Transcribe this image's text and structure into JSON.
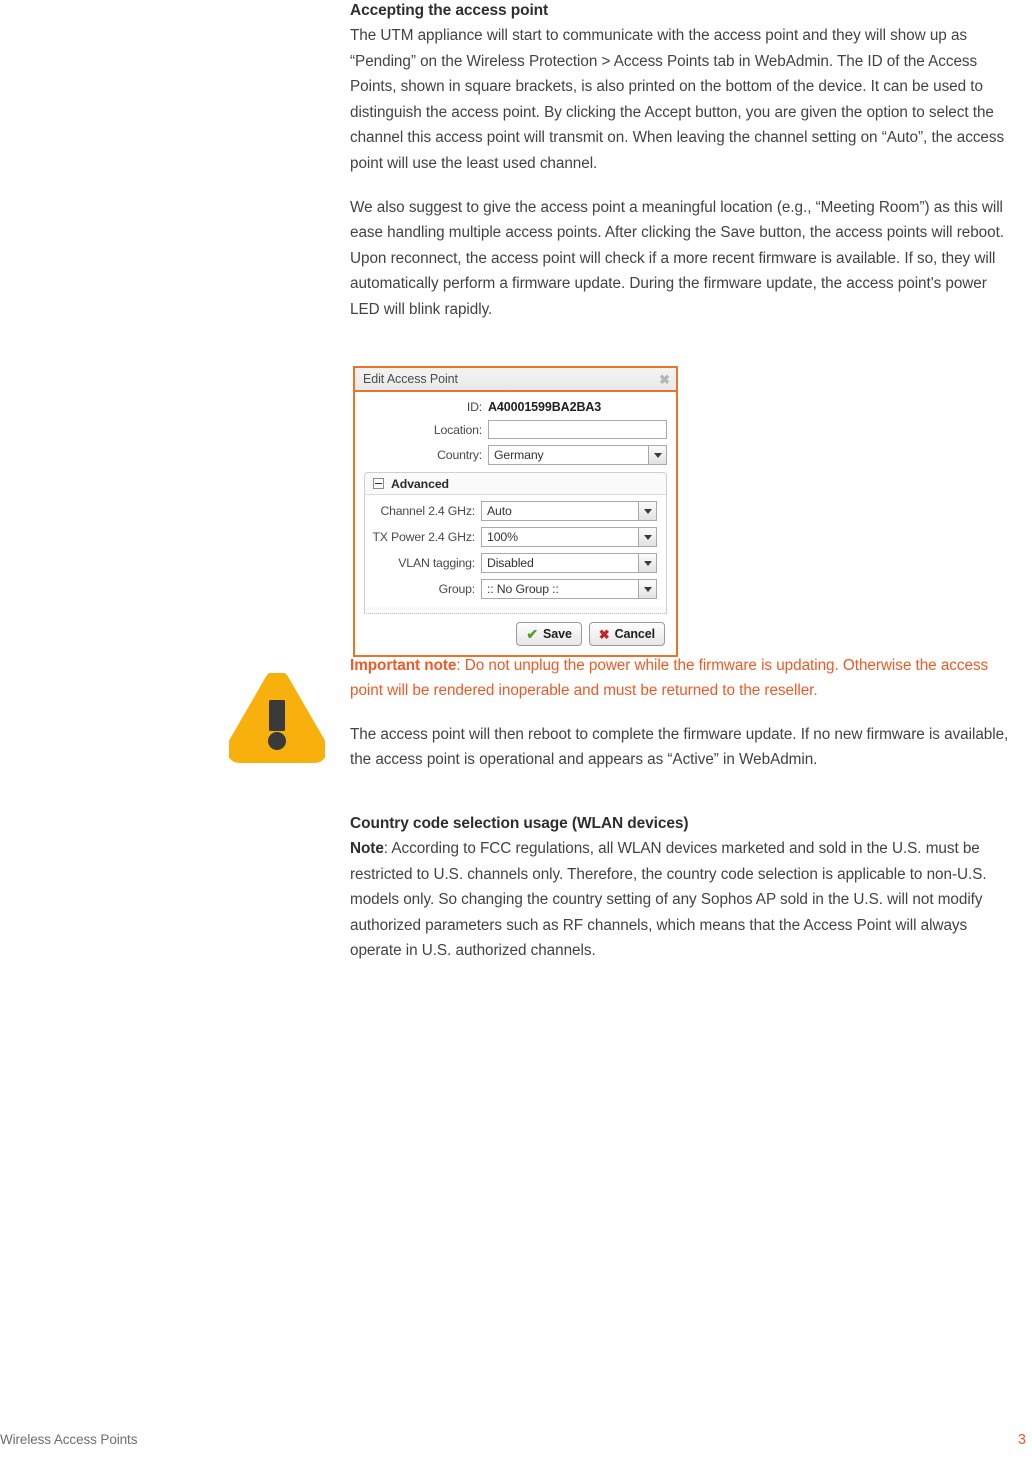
{
  "document": {
    "heading": "Accepting the access point",
    "paragraphs": {
      "p1": "The UTM appliance will start to communicate with the access point and they will show up as “Pending” on the Wireless Protection > Access Points tab in WebAdmin. The ID of the Access Points, shown in square brackets, is also printed on the bottom of the device. It can be used to distinguish the access point. By clicking the Accept button, you are given the option to select the channel this access point will transmit on. When leaving the channel setting on “Auto”, the access point will use the least used channel.",
      "p2": "We also suggest to give the access point a meaningful location (e.g., “Meeting Room”) as this will ease handling multiple access points. After clicking the Save button, the access points will reboot. Upon reconnect, the access point will check if a more recent firmware is available. If so, they will automatically perform a firmware update. During the firmware update, the access point's power LED will blink rapidly.",
      "p3": "The access point will then reboot to complete the firmware update. If no new firmware is available, the access point is operational and appears as “Active” in WebAdmin."
    },
    "important_note": {
      "label": "Important note",
      "separator": ": ",
      "text": "Do not unplug the power while the firmware is updating. Otherwise the access point will be rendered inoperable and must be returned to the reseller.",
      "color": "#ef5a24",
      "icon": "warning-triangle-icon",
      "icon_color": "#f8b00c"
    },
    "country_section": {
      "heading": "Country code selection usage (WLAN devices)",
      "note_label": "Note",
      "note_separator": ": ",
      "note_text": "According to FCC regulations, all WLAN devices marketed and sold in the U.S. must be restricted to U.S. channels only. Therefore, the country code selection is applicable to non-U.S. models only. So changing the country setting of any Sophos AP sold in the U.S. will not modify authorized parameters such as RF channels, which means that the Access Point will always operate in U.S. authorized channels."
    }
  },
  "dialog": {
    "title": "Edit Access Point",
    "close_icon": "close-icon",
    "border_color": "#e8762a",
    "fields": {
      "id": {
        "label": "ID:",
        "value": "A40001599BA2BA3"
      },
      "location": {
        "label": "Location:",
        "value": "",
        "placeholder": ""
      },
      "country": {
        "label": "Country:",
        "value": "Germany"
      }
    },
    "advanced": {
      "title": "Advanced",
      "collapse_icon": "minus-box-icon",
      "rows": [
        {
          "label": "Channel 2.4 GHz:",
          "value": "Auto"
        },
        {
          "label": "TX Power 2.4 GHz:",
          "value": "100%"
        },
        {
          "label": "VLAN tagging:",
          "value": "Disabled"
        },
        {
          "label": "Group:",
          "value": ":: No Group ::"
        }
      ]
    },
    "buttons": {
      "save": {
        "label": "Save",
        "icon": "check-icon",
        "icon_color": "#49a426"
      },
      "cancel": {
        "label": "Cancel",
        "icon": "x-icon",
        "icon_color": "#c32525"
      }
    }
  },
  "footer": {
    "left": "Wireless Access Points",
    "page_number": "3",
    "page_number_color": "#f15a22"
  }
}
